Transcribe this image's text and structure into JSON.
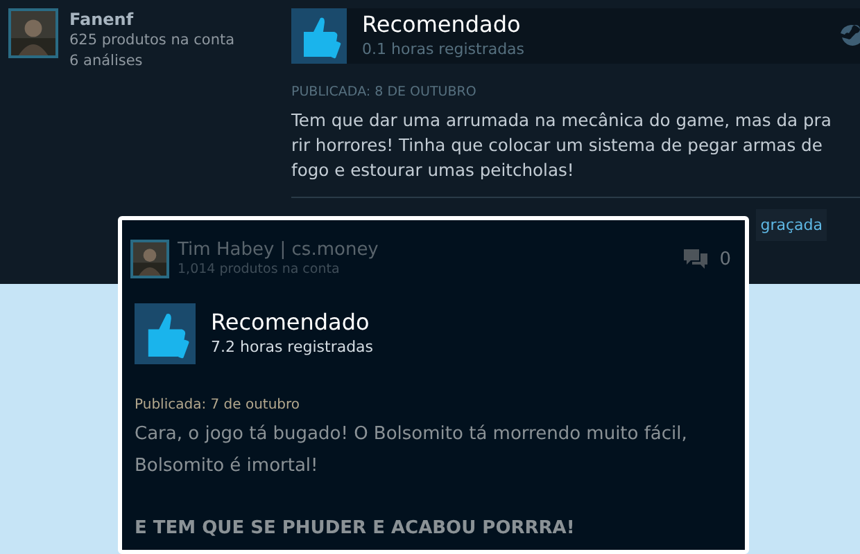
{
  "back_review": {
    "author": {
      "name": "Fanenf",
      "products": "625 produtos na conta",
      "reviews": "6 análises"
    },
    "verdict": "Recomendado",
    "recommended": true,
    "hours": "0.1 horas registradas",
    "posted": "PUBLICADA: 8 DE OUTUBRO",
    "body": "Tem que dar uma arrumada na mecânica do game, mas da pra rir horrores! Tinha que colocar um sistema de pegar armas de fogo e estourar umas peitcholas!",
    "vote_button": "graçada"
  },
  "front_review": {
    "author": {
      "name": "Tim Habey | cs.money",
      "products": "1,014 produtos na conta"
    },
    "comments": "0",
    "verdict": "Recomendado",
    "recommended": true,
    "hours": "7.2 horas registradas",
    "posted": "Publicada: 7 de outubro",
    "body": [
      "Cara, o jogo tá bugado! O Bolsomito tá morrendo muito fácil, Bolsomito é imortal!",
      "E TEM QUE SE PHUDER E ACABOU PORRRA!"
    ]
  }
}
